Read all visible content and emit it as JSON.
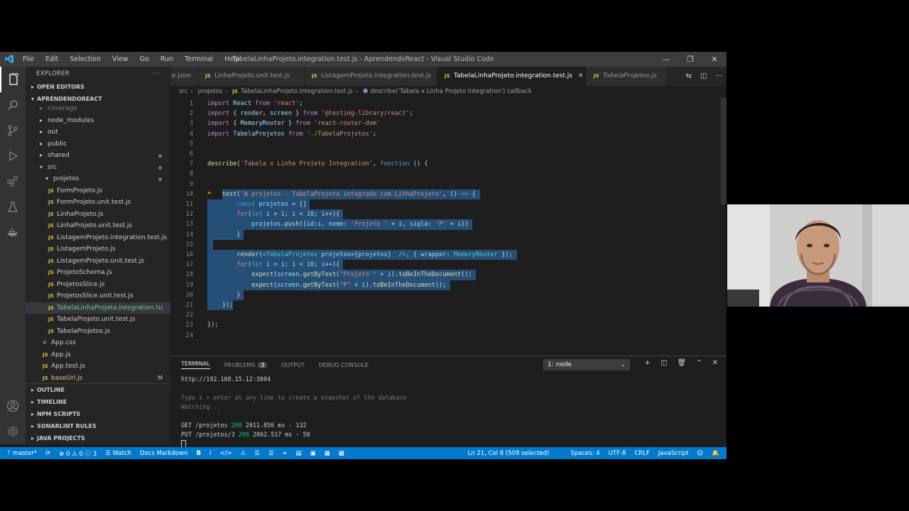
{
  "window": {
    "title": "TabelaLinhaProjeto.integration.test.js - AprendendoReact - Visual Studio Code",
    "menu": [
      "File",
      "Edit",
      "Selection",
      "View",
      "Go",
      "Run",
      "Terminal",
      "Help"
    ]
  },
  "sidebar": {
    "header": "EXPLORER",
    "open_editors": "OPEN EDITORS",
    "workspace": "APRENDENDOREACT",
    "items": [
      {
        "label": "coverage",
        "kind": "folder",
        "depth": 1,
        "faded": true
      },
      {
        "label": "node_modules",
        "kind": "folder",
        "depth": 1
      },
      {
        "label": "out",
        "kind": "folder",
        "depth": 1
      },
      {
        "label": "public",
        "kind": "folder",
        "depth": 1
      },
      {
        "label": "shared",
        "kind": "folder",
        "depth": 1,
        "status": "dot"
      },
      {
        "label": "src",
        "kind": "folder-open",
        "depth": 1,
        "status": "dot"
      },
      {
        "label": "projetos",
        "kind": "folder-open",
        "depth": 2,
        "status": "dot"
      },
      {
        "label": "FormProjeto.js",
        "kind": "js",
        "depth": 3
      },
      {
        "label": "FormProjeto.unit.test.js",
        "kind": "js",
        "depth": 3
      },
      {
        "label": "LinhaProjeto.js",
        "kind": "js",
        "depth": 3
      },
      {
        "label": "LinhaProjeto.unit.test.js",
        "kind": "js",
        "depth": 3
      },
      {
        "label": "ListagemProjeto.integration.test.js",
        "kind": "js",
        "depth": 3
      },
      {
        "label": "ListagemProjeto.js",
        "kind": "js",
        "depth": 3
      },
      {
        "label": "ListagemProjeto.unit.test.js",
        "kind": "js",
        "depth": 3
      },
      {
        "label": "ProjetoSchema.js",
        "kind": "js",
        "depth": 3
      },
      {
        "label": "ProjetosSlice.js",
        "kind": "js",
        "depth": 3
      },
      {
        "label": "ProjetosSlice.unit.test.js",
        "kind": "js",
        "depth": 3
      },
      {
        "label": "TabelaLinhaProjeto.integration.t...",
        "kind": "js",
        "depth": 3,
        "selected": true,
        "badge": "U"
      },
      {
        "label": "TabelaProjeto.unit.test.js",
        "kind": "js",
        "depth": 3
      },
      {
        "label": "TabelaProjetos.js",
        "kind": "js",
        "depth": 3
      },
      {
        "label": "App.css",
        "kind": "css",
        "depth": 2
      },
      {
        "label": "App.js",
        "kind": "js",
        "depth": 2
      },
      {
        "label": "App.test.js",
        "kind": "js",
        "depth": 2
      },
      {
        "label": "baseUrl.js",
        "kind": "js",
        "depth": 2,
        "badge": "M"
      }
    ],
    "bottom_sections": [
      "OUTLINE",
      "TIMELINE",
      "NPM SCRIPTS",
      "SONARLINT RULES",
      "JAVA PROJECTS"
    ]
  },
  "tabs": [
    {
      "label": "e.json",
      "icon": "json-icon"
    },
    {
      "label": "LinhaProjeto.unit.test.js",
      "icon": "js-icon"
    },
    {
      "label": "ListagemProjeto.integration.test.js",
      "icon": "js-icon"
    },
    {
      "label": "TabelaLinhaProjeto.integration.test.js",
      "icon": "js-icon",
      "active": true
    },
    {
      "label": "TabelaProjetos.js",
      "icon": "js-icon",
      "italic": true
    }
  ],
  "breadcrumb": [
    "src",
    "projetos",
    "TabelaLinhaProjeto.integration.test.js",
    "describe('Tabela x Linha Projeto Integration') callback"
  ],
  "editor": {
    "lines": [
      {
        "n": "1",
        "tokens": [
          [
            "kw",
            "import"
          ],
          [
            "pun",
            " "
          ],
          [
            "var",
            "React"
          ],
          [
            "pun",
            " "
          ],
          [
            "kw",
            "from"
          ],
          [
            "pun",
            " "
          ],
          [
            "str",
            "'react'"
          ],
          [
            "pun",
            ";"
          ]
        ]
      },
      {
        "n": "2",
        "tokens": [
          [
            "kw",
            "import"
          ],
          [
            "pun",
            " { "
          ],
          [
            "var",
            "render"
          ],
          [
            "pun",
            ", "
          ],
          [
            "var",
            "screen"
          ],
          [
            "pun",
            " } "
          ],
          [
            "kw",
            "from"
          ],
          [
            "pun",
            " "
          ],
          [
            "str",
            "'@testing-library/react'"
          ],
          [
            "pun",
            ";"
          ]
        ]
      },
      {
        "n": "3",
        "tokens": [
          [
            "kw",
            "import"
          ],
          [
            "pun",
            " { "
          ],
          [
            "var",
            "MemoryRouter"
          ],
          [
            "pun",
            " } "
          ],
          [
            "kw",
            "from"
          ],
          [
            "pun",
            " "
          ],
          [
            "str",
            "'react-router-dom'"
          ]
        ]
      },
      {
        "n": "4",
        "tokens": [
          [
            "kw",
            "import"
          ],
          [
            "pun",
            " "
          ],
          [
            "var",
            "TabelaProjetos"
          ],
          [
            "pun",
            " "
          ],
          [
            "kw",
            "from"
          ],
          [
            "pun",
            " "
          ],
          [
            "str",
            "'./TabelaProjetos'"
          ],
          [
            "pun",
            ";"
          ]
        ]
      },
      {
        "n": "5",
        "tokens": []
      },
      {
        "n": "6",
        "tokens": []
      },
      {
        "n": "7",
        "tokens": [
          [
            "fn",
            "describe"
          ],
          [
            "pun",
            "("
          ],
          [
            "str",
            "'Tabela x Linha Projeto Integration'"
          ],
          [
            "pun",
            ", "
          ],
          [
            "kw2",
            "function"
          ],
          [
            "pun",
            " () {"
          ]
        ]
      },
      {
        "n": "8",
        "tokens": []
      },
      {
        "n": "9",
        "tokens": []
      },
      {
        "n": "10",
        "tokens": [
          [
            "pun",
            "    "
          ],
          [
            "fn",
            "test"
          ],
          [
            "pun",
            "("
          ],
          [
            "str",
            "'N projetos - TabelaProjeto integrado com LinhaProjeto'"
          ],
          [
            "pun",
            ", () "
          ],
          [
            "kw2",
            "=>"
          ],
          [
            "pun",
            " {"
          ]
        ]
      },
      {
        "n": "11",
        "tokens": [
          [
            "pun",
            "        "
          ],
          [
            "kw2",
            "const"
          ],
          [
            "pun",
            " "
          ],
          [
            "var",
            "projetos"
          ],
          [
            "pun",
            " = []"
          ]
        ]
      },
      {
        "n": "12",
        "tokens": [
          [
            "pun",
            "        "
          ],
          [
            "kw",
            "for"
          ],
          [
            "pun",
            "("
          ],
          [
            "kw2",
            "let"
          ],
          [
            "pun",
            " "
          ],
          [
            "var",
            "i"
          ],
          [
            "pun",
            " = "
          ],
          [
            "num",
            "1"
          ],
          [
            "pun",
            "; "
          ],
          [
            "var",
            "i"
          ],
          [
            "pun",
            " < "
          ],
          [
            "num",
            "10"
          ],
          [
            "pun",
            "; "
          ],
          [
            "var",
            "i"
          ],
          [
            "pun",
            "++){"
          ]
        ]
      },
      {
        "n": "13",
        "tokens": [
          [
            "pun",
            "            "
          ],
          [
            "var",
            "projetos"
          ],
          [
            "pun",
            "."
          ],
          [
            "fn",
            "push"
          ],
          [
            "pun",
            "({"
          ],
          [
            "var",
            "id"
          ],
          [
            "pun",
            ":"
          ],
          [
            "var",
            "i"
          ],
          [
            "pun",
            ", "
          ],
          [
            "var",
            "nome"
          ],
          [
            "pun",
            ": "
          ],
          [
            "str",
            "'Projeto '"
          ],
          [
            "pun",
            " + "
          ],
          [
            "var",
            "i"
          ],
          [
            "pun",
            ", "
          ],
          [
            "var",
            "sigla"
          ],
          [
            "pun",
            ": "
          ],
          [
            "str",
            "'P'"
          ],
          [
            "pun",
            " + "
          ],
          [
            "var",
            "i"
          ],
          [
            "pun",
            "})"
          ]
        ]
      },
      {
        "n": "14",
        "tokens": [
          [
            "pun",
            "        }"
          ]
        ]
      },
      {
        "n": "15",
        "tokens": []
      },
      {
        "n": "16",
        "tokens": [
          [
            "pun",
            "        "
          ],
          [
            "fn",
            "render"
          ],
          [
            "pun",
            "("
          ],
          [
            "cls",
            "<TabelaProjetos"
          ],
          [
            "pun",
            " "
          ],
          [
            "var",
            "projetos"
          ],
          [
            "pun",
            "="
          ],
          [
            "pun",
            "{"
          ],
          [
            "var",
            "projetos"
          ],
          [
            "pun",
            "}"
          ],
          [
            "pun",
            "  "
          ],
          [
            "cls",
            "/>"
          ],
          [
            "pun",
            ", { "
          ],
          [
            "var",
            "wrapper"
          ],
          [
            "pun",
            ": "
          ],
          [
            "cls",
            "MemoryRouter"
          ],
          [
            "pun",
            " });"
          ]
        ]
      },
      {
        "n": "17",
        "tokens": [
          [
            "pun",
            "        "
          ],
          [
            "kw",
            "for"
          ],
          [
            "pun",
            "("
          ],
          [
            "kw2",
            "let"
          ],
          [
            "pun",
            " "
          ],
          [
            "var",
            "i"
          ],
          [
            "pun",
            " = "
          ],
          [
            "num",
            "1"
          ],
          [
            "pun",
            "; "
          ],
          [
            "var",
            "i"
          ],
          [
            "pun",
            " < "
          ],
          [
            "num",
            "10"
          ],
          [
            "pun",
            "; "
          ],
          [
            "var",
            "i"
          ],
          [
            "pun",
            "++){"
          ]
        ]
      },
      {
        "n": "18",
        "tokens": [
          [
            "pun",
            "            "
          ],
          [
            "fn",
            "expect"
          ],
          [
            "pun",
            "("
          ],
          [
            "var",
            "screen"
          ],
          [
            "pun",
            "."
          ],
          [
            "fn",
            "getByText"
          ],
          [
            "pun",
            "("
          ],
          [
            "str",
            "\"Projeto \""
          ],
          [
            "pun",
            " + "
          ],
          [
            "var",
            "i"
          ],
          [
            "pun",
            ")."
          ],
          [
            "fn",
            "toBeInTheDocument"
          ],
          [
            "pun",
            "();"
          ]
        ]
      },
      {
        "n": "19",
        "tokens": [
          [
            "pun",
            "            "
          ],
          [
            "fn",
            "expect"
          ],
          [
            "pun",
            "("
          ],
          [
            "var",
            "screen"
          ],
          [
            "pun",
            "."
          ],
          [
            "fn",
            "getByText"
          ],
          [
            "pun",
            "("
          ],
          [
            "str",
            "\"P\""
          ],
          [
            "pun",
            " + "
          ],
          [
            "var",
            "i"
          ],
          [
            "pun",
            ")."
          ],
          [
            "fn",
            "toBeInTheDocument"
          ],
          [
            "pun",
            "();"
          ]
        ]
      },
      {
        "n": "20",
        "tokens": [
          [
            "pun",
            "        }"
          ]
        ]
      },
      {
        "n": "21",
        "tokens": [
          [
            "pun",
            "    });"
          ]
        ]
      },
      {
        "n": "22",
        "tokens": []
      },
      {
        "n": "23",
        "tokens": [
          [
            "pun",
            "});"
          ]
        ]
      },
      {
        "n": "24",
        "tokens": []
      }
    ],
    "selected_from_line": 10,
    "selected_to_line": 21
  },
  "panel": {
    "tabs": [
      {
        "label": "TERMINAL",
        "active": true
      },
      {
        "label": "PROBLEMS",
        "count": "3"
      },
      {
        "label": "OUTPUT"
      },
      {
        "label": "DEBUG CONSOLE"
      }
    ],
    "terminal_select": "1: node",
    "terminal_lines": [
      {
        "text": "http://192.168.15.12:3004",
        "style": "normal"
      },
      {
        "text": "",
        "style": "normal"
      },
      {
        "text": "Type s + enter at any time to create a snapshot of the database",
        "style": "dim"
      },
      {
        "text": "Watching...",
        "style": "dim"
      },
      {
        "text": "",
        "style": "normal"
      },
      {
        "parts": [
          [
            "GET /projetos ",
            "normal"
          ],
          [
            "200",
            "green"
          ],
          [
            " 2011.856 ms - 132",
            "normal"
          ]
        ]
      },
      {
        "parts": [
          [
            "PUT /projetos/3 ",
            "normal"
          ],
          [
            "200",
            "green"
          ],
          [
            " 2062.517 ms - 58",
            "normal"
          ]
        ]
      }
    ]
  },
  "statusbar": {
    "branch": "master*",
    "problems_errors": "0",
    "problems_warnings": "0",
    "info_count": "3",
    "watch": "Watch",
    "docs_markdown": "Docs Markdown",
    "position": "Ln 21, Col 8 (509 selected)",
    "spaces": "Spaces: 4",
    "encoding": "UTF-8",
    "eol": "CRLF",
    "language": "JavaScript"
  },
  "colors": {
    "accent": "#007acc",
    "selection": "#264f78",
    "editor_bg": "#1e1e1e",
    "sidebar_bg": "#252526"
  }
}
